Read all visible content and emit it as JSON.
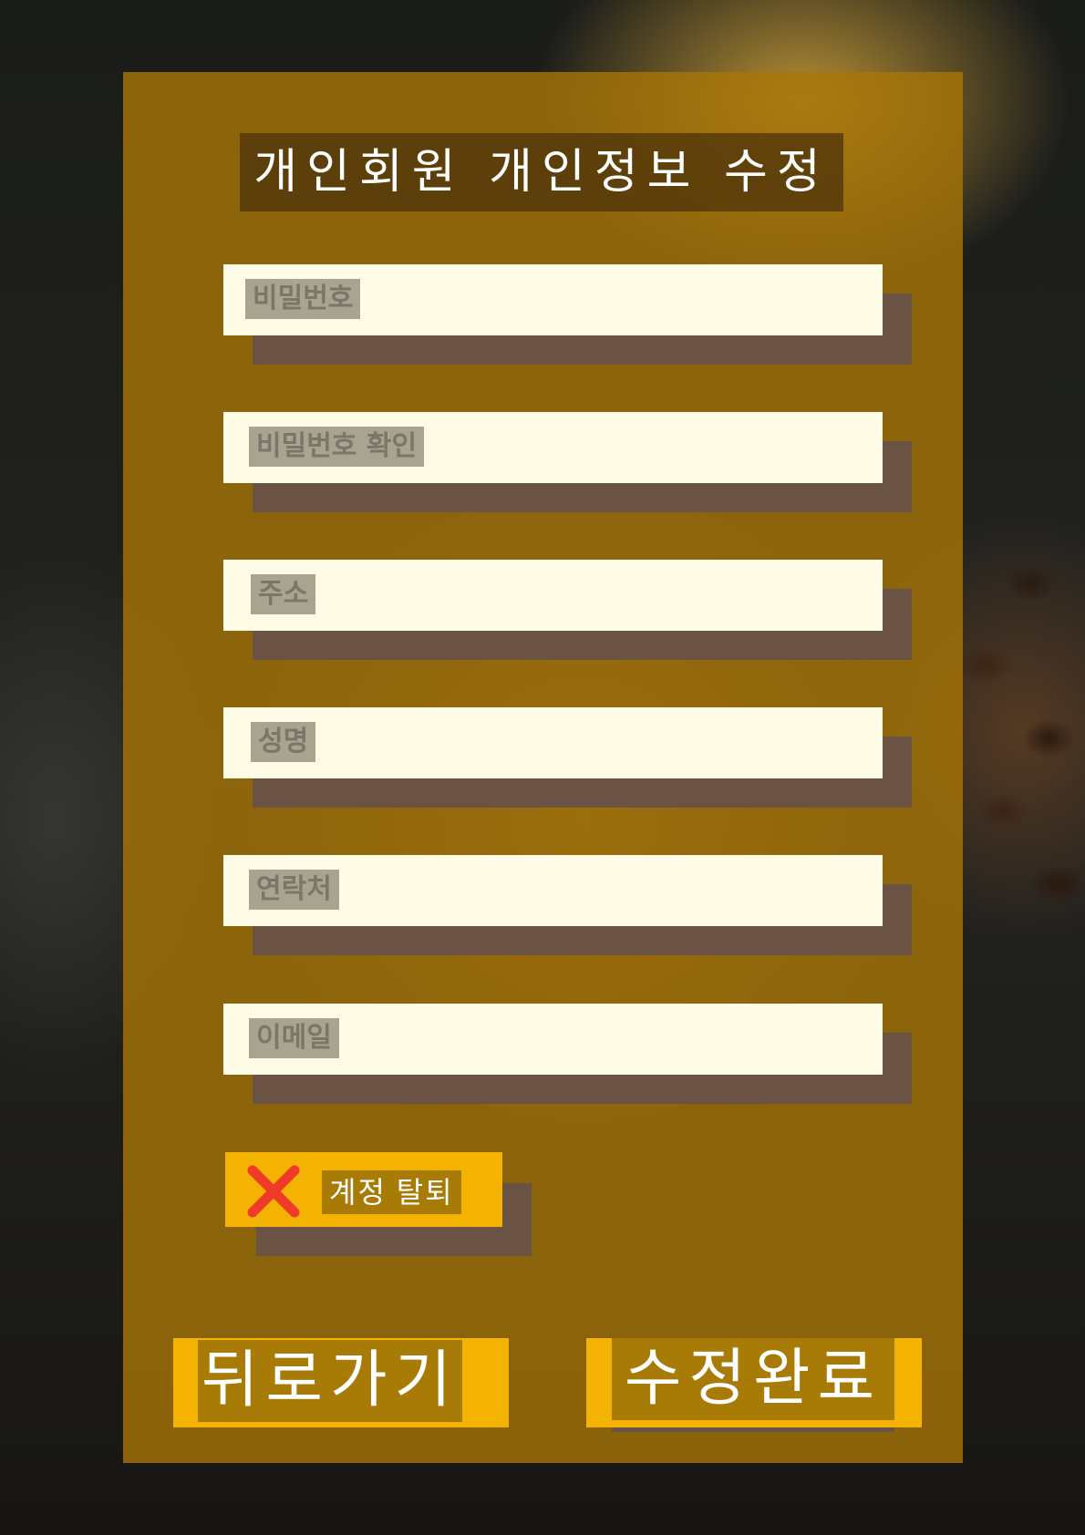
{
  "title": "개인회원 개인정보 수정",
  "fields": [
    {
      "label": "비밀번호"
    },
    {
      "label": "비밀번호 확인"
    },
    {
      "label": "주소"
    },
    {
      "label": "성명"
    },
    {
      "label": "연락처"
    },
    {
      "label": "이메일"
    }
  ],
  "withdraw": {
    "label": "계정 탈퇴",
    "icon": "close-x-icon",
    "icon_color": "#f03a2a"
  },
  "buttons": {
    "back": "뒤로가기",
    "submit": "수정완료"
  },
  "colors": {
    "panel": "#a87608",
    "accent": "#f4b303",
    "field": "#fefbe6",
    "shadow": "#6b5343"
  }
}
